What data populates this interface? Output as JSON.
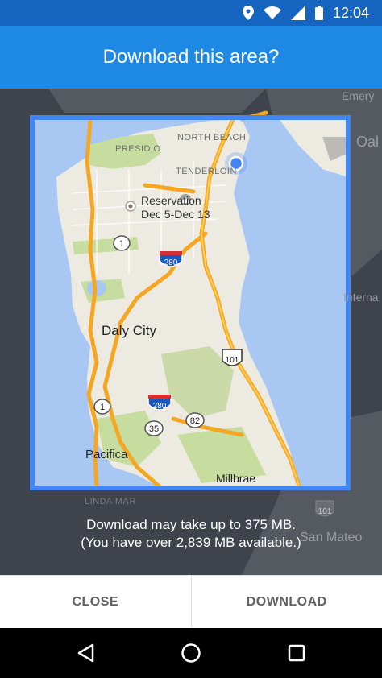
{
  "status_bar": {
    "time": "12:04",
    "icons": [
      "location-icon",
      "wifi-icon",
      "signal-icon",
      "battery-icon"
    ]
  },
  "dialog": {
    "title": "Download this area?",
    "info_line1": "Download may take up to 375 MB.",
    "info_line2": "(You have over 2,839 MB available.)"
  },
  "map": {
    "labels": {
      "north_beach": "NORTH BEACH",
      "presidio": "PRESIDIO",
      "tenderloin": "TENDERLOIN",
      "reservation_title": "Reservation",
      "reservation_dates": "Dec 5-Dec 13",
      "daly_city": "Daly City",
      "pacifica": "Pacifica",
      "millbrae": "Millbrae",
      "linda_mar": "LINDA MAR",
      "emeryville": "Emery",
      "oakland": "Oal",
      "international": "Interna",
      "san_mateo": "San Mateo"
    },
    "shields": {
      "hwy_1_a": "1",
      "hwy_1_b": "1",
      "i280_a": "280",
      "i280_b": "280",
      "us101_a": "101",
      "us101_b": "101",
      "hwy_35": "35",
      "hwy_82": "82"
    }
  },
  "actions": {
    "close_label": "CLOSE",
    "download_label": "DOWNLOAD"
  },
  "nav": {
    "icons": [
      "back-icon",
      "home-icon",
      "recents-icon"
    ]
  },
  "colors": {
    "status_bar": "#1565C0",
    "app_bar": "#1E88E5",
    "water": "#A9C7F3",
    "land": "#EDEAE2",
    "highway": "#F5A623",
    "selection_border": "#4285F4",
    "dim_overlay": "#3E434C"
  }
}
